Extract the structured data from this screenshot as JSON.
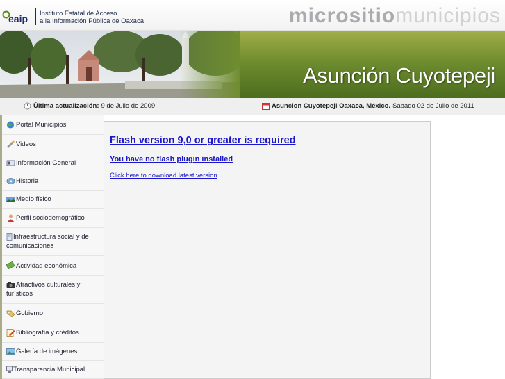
{
  "header": {
    "logo_text": "eaip",
    "institution_line1": "Instituto Estatal de Acceso",
    "institution_line2": "a la Información Pública de Oaxaca",
    "micrositio_word1": "micrositio",
    "micrositio_word2": "municipios"
  },
  "banner": {
    "town_name": "Asunción Cuyotepeji"
  },
  "info_bar": {
    "update_label": "Última actualización:",
    "update_date": "9 de Julio de 2009",
    "location_label": "Asuncion Cuyotepeji Oaxaca, México.",
    "current_date": "Sabado 02 de Julio de 2011"
  },
  "sidebar": {
    "items": [
      {
        "label": "Portal Municipios",
        "icon": "globe-icon"
      },
      {
        "label": "Videos",
        "icon": "pencil-icon"
      },
      {
        "label": "Información General",
        "icon": "id-card-icon"
      },
      {
        "label": "Historia",
        "icon": "disc-icon"
      },
      {
        "label": "Medio físico",
        "icon": "landscape-icon"
      },
      {
        "label": "Perfil sociodemográfico",
        "icon": "person-icon"
      },
      {
        "label": "Infraestructura social y de comunicaciones",
        "icon": "document-icon"
      },
      {
        "label": "Actividad económica",
        "icon": "money-icon"
      },
      {
        "label": "Atractivos culturales y turísticos",
        "icon": "camera-icon"
      },
      {
        "label": "Gobierno",
        "icon": "tag-icon"
      },
      {
        "label": "Bibliografía y créditos",
        "icon": "notepad-icon"
      },
      {
        "label": "Galería de imágenes",
        "icon": "picture-icon"
      },
      {
        "label": "Transparencia Municipal",
        "icon": "monitor-icon"
      }
    ]
  },
  "content": {
    "flash_heading": "Flash version 9,0 or greater is required",
    "flash_subheading": "You have no flash plugin installed",
    "download_link": "Click here to download latest version"
  },
  "colors": {
    "link_blue": "#1a16c9",
    "banner_green": "#6f8d2f",
    "sidebar_bg": "#f3f3f3"
  }
}
